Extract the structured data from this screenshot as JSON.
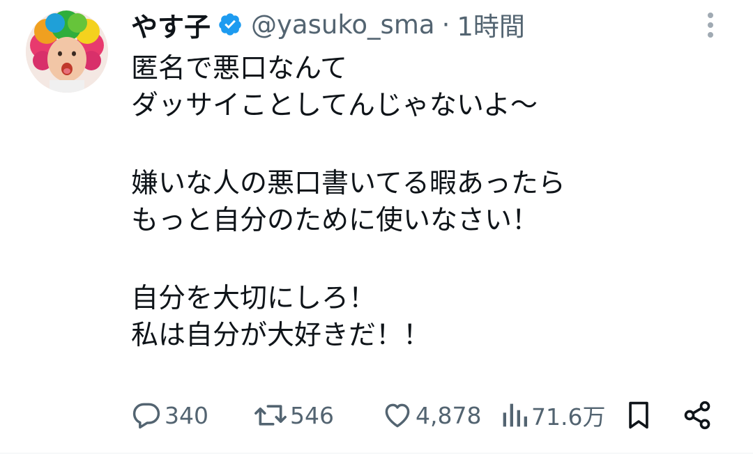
{
  "author": {
    "name": "やす子",
    "handle": "@yasuko_sma",
    "separator": "·",
    "time": "1時間",
    "verified": true
  },
  "body": {
    "paragraphs": [
      [
        "匿名で悪口なんて",
        "ダッサイことしてんじゃないよ～"
      ],
      [
        "嫌いな人の悪口書いてる暇あったら",
        "もっと自分のために使いなさい！"
      ],
      [
        "自分を大切にしろ！",
        "私は自分が大好きだ！！"
      ]
    ]
  },
  "actions": {
    "reply": {
      "icon": "reply-icon",
      "count": "340"
    },
    "retweet": {
      "icon": "retweet-icon",
      "count": "546"
    },
    "like": {
      "icon": "heart-icon",
      "count": "4,878"
    },
    "views": {
      "icon": "views-icon",
      "count": "71.6万"
    },
    "bookmark": {
      "icon": "bookmark-icon"
    },
    "share": {
      "icon": "share-icon"
    }
  },
  "colors": {
    "text": "#0f1419",
    "secondary": "#536471",
    "verified": "#1d9bf0",
    "background": "#ffffff"
  }
}
